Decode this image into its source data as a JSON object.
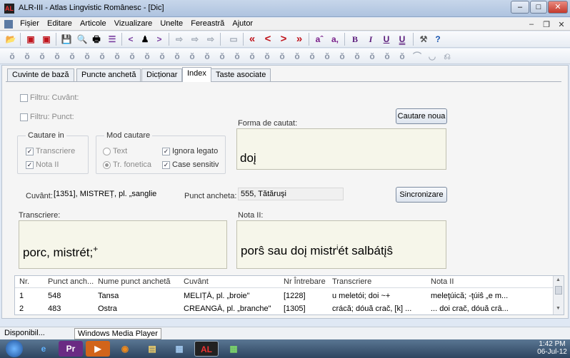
{
  "window": {
    "title": "ALR-III - Atlas Lingvistic Românesc - [Dic]",
    "app_icon": "AL",
    "min": "–",
    "max": "□",
    "close": "✕"
  },
  "menu": {
    "items": [
      "Fișier",
      "Editare",
      "Articole",
      "Vizualizare",
      "Unelte",
      "Fereastră",
      "Ajutor"
    ],
    "mdi_min": "–",
    "mdi_max": "❐",
    "mdi_close": "✕"
  },
  "toolbar1": {
    "b_open": "📂",
    "b_red": "▣",
    "b_save": "💾",
    "b_preview": "🔍",
    "b_print": "🖶",
    "b_list": "☰",
    "b_prev": "<",
    "b_find": "♟",
    "b_next": ">",
    "b_a": "⇨",
    "b_b": "⇨",
    "b_c": "⇨",
    "b_rect": "▭",
    "b_first": "«",
    "b_back": "<",
    "b_fwd": ">",
    "b_last": "»",
    "sup": "aˆ",
    "sub": "a,",
    "bold": "B",
    "italic": "I",
    "underline": "U",
    "underline2": "U",
    "tools": "⚒",
    "help": "?"
  },
  "toolbar2": {
    "glyphs": [
      "ŏ",
      "ŏ",
      "ŏ",
      "ŏ",
      "ŏ",
      "ŏ",
      "ŏ",
      "ŏ",
      "ŏ",
      "ŏ",
      "ŏ",
      "ŏ",
      "ŏ",
      "ŏ",
      "ŏ",
      "ŏ",
      "ŏ",
      "ŏ",
      "ŏ",
      "ŏ",
      "ŏ",
      "ŏ",
      "ŏ",
      "ŏ",
      "ŏ",
      "ŏ",
      "ŏ",
      "⌒",
      "◡",
      "⎌"
    ]
  },
  "tabs": [
    "Cuvinte de bază",
    "Puncte anchetă",
    "Dicționar",
    "Index",
    "Taste asociate"
  ],
  "filters": {
    "filtru_cuvant": "Filtru: Cuvânt:",
    "filtru_punct": "Filtru: Punct:"
  },
  "cautare": {
    "group_in": "Cautare in",
    "transcriere": "Transcriere",
    "nota": "Nota II",
    "group_mod": "Mod cautare",
    "text": "Text",
    "tr_fonetica": "Tr. fonetica",
    "ignora": "Ignora legato",
    "case": "Case sensitiv"
  },
  "forma": {
    "label": "Forma de cautat:",
    "value": "doį",
    "button": "Cautare noua"
  },
  "info": {
    "cuvant_label": "Cuvânt:",
    "cuvant_value": "[1351], MISTREȚ, pl. „sanglie",
    "punct_label": "Punct ancheta:",
    "punct_value": "555, Tătăruşi",
    "sync": "Sincronizare"
  },
  "transcriere": {
    "label": "Transcriere:",
    "value": "porc, mistrét;",
    "sup": "+"
  },
  "nota": {
    "label": "Nota II:",
    "value_a": "porŝ sau doį mistr",
    "value_sup": "i",
    "value_b": "ét salbátįŝ"
  },
  "grid": {
    "headers": [
      "Nr.",
      "Punct anch...",
      "Nume punct anchetă",
      "Cuvânt",
      "Nr Întrebare",
      "Transcriere",
      "Nota II"
    ],
    "rows": [
      [
        "1",
        "548",
        "Tansa",
        "MELIȚĂ, pl. „broie\"",
        "[1228]",
        "u meletói; doi ~+",
        "meleţúică; -ţúiŝ „e m..."
      ],
      [
        "2",
        "483",
        "Ostra",
        "CREANGĂ, pl. „branche\"",
        "[1305]",
        "crácă; dóuă crač, [k] ...",
        "... doi crač, dóuă crā..."
      ]
    ]
  },
  "status": {
    "text": "Disponibil...",
    "tooltip": "Windows Media Player"
  },
  "taskbar": {
    "time": "1:42 PM",
    "date": "06-Jul-12",
    "apps": [
      "e",
      "Pr",
      "▶",
      "◉",
      "▤",
      "▦",
      "AL",
      "▦"
    ]
  },
  "colors": {
    "accent": "#4f78b0",
    "field_bg": "#f6f6ea",
    "red_nav": "#c0141c"
  }
}
